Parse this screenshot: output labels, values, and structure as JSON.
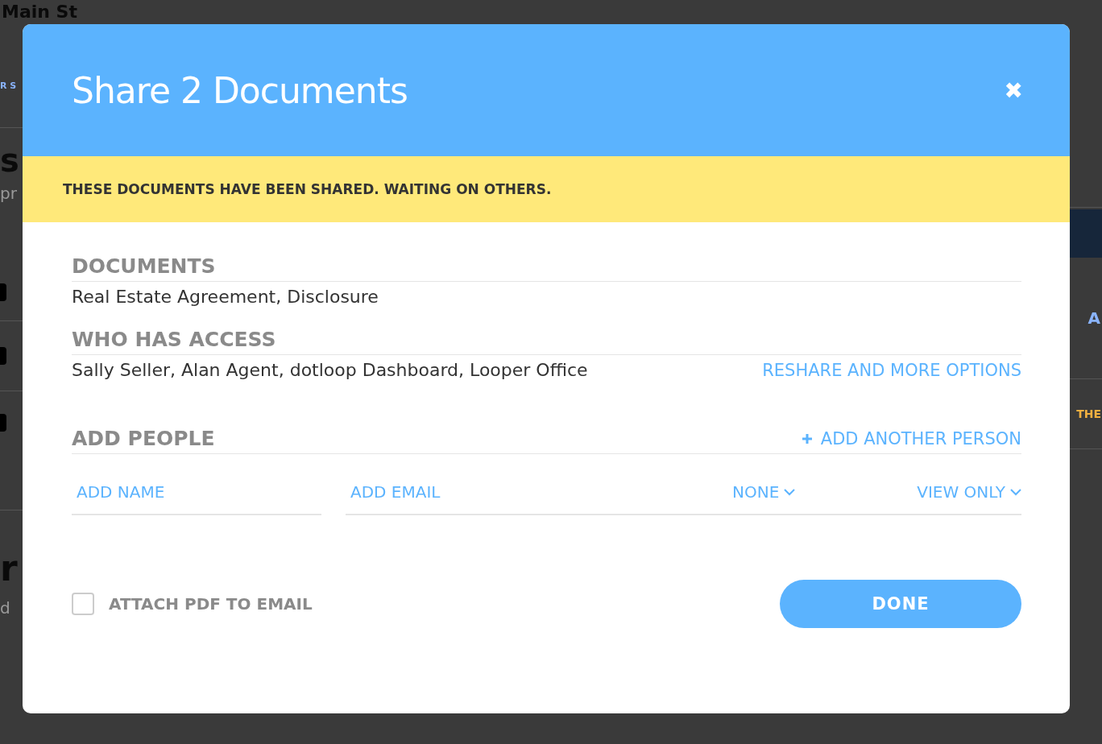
{
  "background_page": {
    "title": "Main St",
    "subtitle": "R S",
    "heading": "s",
    "subheading": "pr",
    "right_column_label": "A",
    "right_status": "THE",
    "section_heading": "r",
    "section_text": "d"
  },
  "dialog": {
    "title": "Share 2 Documents",
    "close": "✖",
    "banner": "THESE DOCUMENTS HAVE BEEN SHARED. WAITING ON OTHERS.",
    "documents": {
      "heading": "DOCUMENTS",
      "value": "Real Estate Agreement, Disclosure"
    },
    "access": {
      "heading": "WHO HAS ACCESS",
      "value": "Sally Seller, Alan Agent, dotloop Dashboard, Looper Office",
      "link": "RESHARE AND MORE OPTIONS"
    },
    "add_people": {
      "heading": "ADD PEOPLE",
      "add_link": "ADD ANOTHER PERSON",
      "name_placeholder": "ADD NAME",
      "email_placeholder": "ADD EMAIL",
      "role": "NONE",
      "permission": "VIEW ONLY"
    },
    "attach_pdf": {
      "label": "ATTACH PDF TO EMAIL",
      "checked": false
    },
    "done": "DONE"
  }
}
